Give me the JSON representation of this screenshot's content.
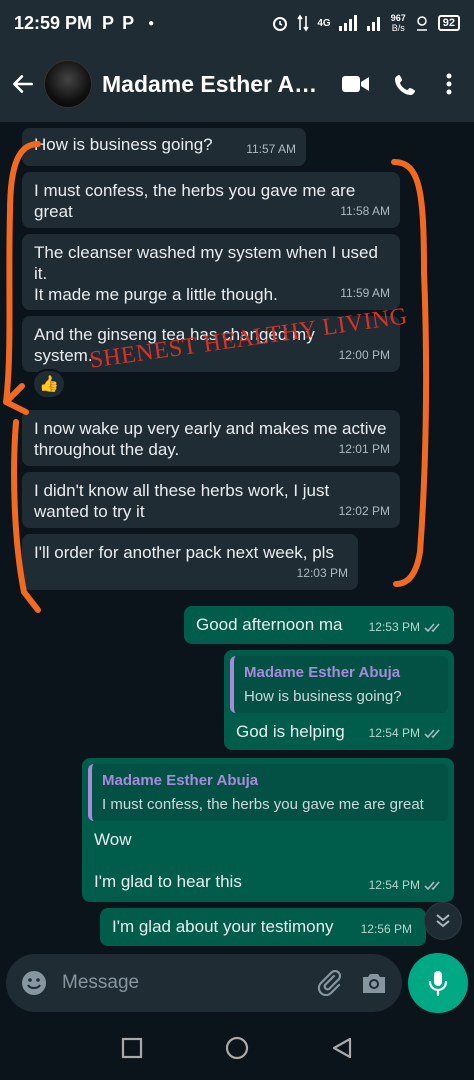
{
  "status_bar": {
    "time": "12:59 PM",
    "notif_icons": [
      "P",
      "P"
    ],
    "network": "4G",
    "speed_value": "967",
    "speed_unit": "B/s",
    "battery": "92"
  },
  "header": {
    "contact_name": "Madame Esther Abuja",
    "icons": [
      "back-arrow-icon",
      "video-call-icon",
      "voice-call-icon",
      "more-options-icon"
    ]
  },
  "messages": [
    {
      "dir": "in",
      "text": "How is business going?",
      "time": "11:57 AM"
    },
    {
      "dir": "in",
      "text": "I must confess, the herbs you gave me are great",
      "time": "11:58 AM"
    },
    {
      "dir": "in",
      "text": "The cleanser washed my system when I used it.\nIt made me purge a little though.",
      "time": "11:59 AM"
    },
    {
      "dir": "in",
      "text": "And the ginseng tea has changed my system.",
      "time": "12:00 PM",
      "reaction": "👍"
    },
    {
      "dir": "in",
      "text": "I now wake up very early and makes me active throughout the day.",
      "time": "12:01 PM"
    },
    {
      "dir": "in",
      "text": "I didn't know all these herbs work, I just wanted to try it",
      "time": "12:02 PM"
    },
    {
      "dir": "in",
      "text": "I'll order for another pack next week, pls",
      "time": "12:03 PM"
    },
    {
      "dir": "out",
      "text": "Good afternoon ma",
      "time": "12:53 PM"
    },
    {
      "dir": "out",
      "text": "God is helping",
      "time": "12:54 PM",
      "quote": {
        "name": "Madame Esther Abuja",
        "text": "How is business going?"
      }
    },
    {
      "dir": "out",
      "text": "Wow\n\nI'm glad to hear this",
      "time": "12:54 PM",
      "quote": {
        "name": "Madame Esther Abuja",
        "text": "I must confess, the herbs you gave me are great"
      }
    },
    {
      "dir": "out",
      "text": "I'm glad about your testimony",
      "time": "12:56 PM"
    }
  ],
  "watermark": "SHENEST HEALTHY LIVING",
  "composer": {
    "placeholder": "Message",
    "icons": [
      "emoji-icon",
      "attach-icon",
      "camera-icon",
      "mic-icon"
    ]
  },
  "colors": {
    "header_bg": "#1f2c34",
    "chat_bg": "#0b141a",
    "incoming_bubble": "#202c33",
    "outgoing_bubble": "#005c4b",
    "accent": "#00a884",
    "annotation": "#f26a21",
    "watermark": "#d8312a"
  }
}
